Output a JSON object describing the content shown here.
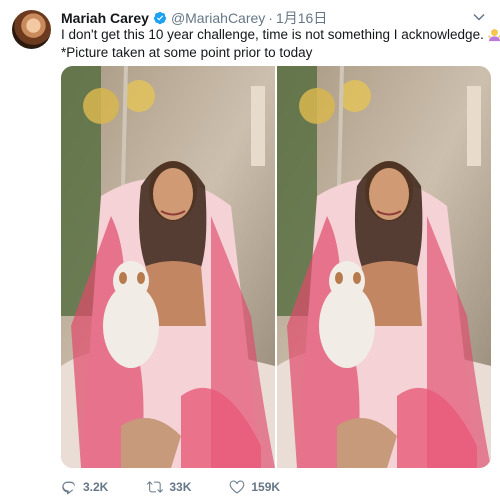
{
  "tweet": {
    "author": {
      "display_name": "Mariah Carey",
      "handle": "@MariahCarey",
      "verified": true
    },
    "separator": "·",
    "timestamp": "1月16日",
    "text_line_1": "I don't get this 10 year challenge, time is not something I acknowledge.",
    "emoji": "woman-shrugging-emoji",
    "text_line_2": "*Picture taken at some point prior to today",
    "media": {
      "count": 2,
      "description_icons": [
        "photo-left",
        "photo-right"
      ]
    },
    "actions": {
      "reply_count": "3.2K",
      "retweet_count": "33K",
      "like_count": "159K"
    }
  },
  "colors": {
    "text": "#14171a",
    "secondary": "#657786",
    "verified_blue": "#1da1f2"
  },
  "icons": [
    "verified-icon",
    "chevron-down-icon",
    "reply-icon",
    "retweet-icon",
    "like-icon"
  ]
}
